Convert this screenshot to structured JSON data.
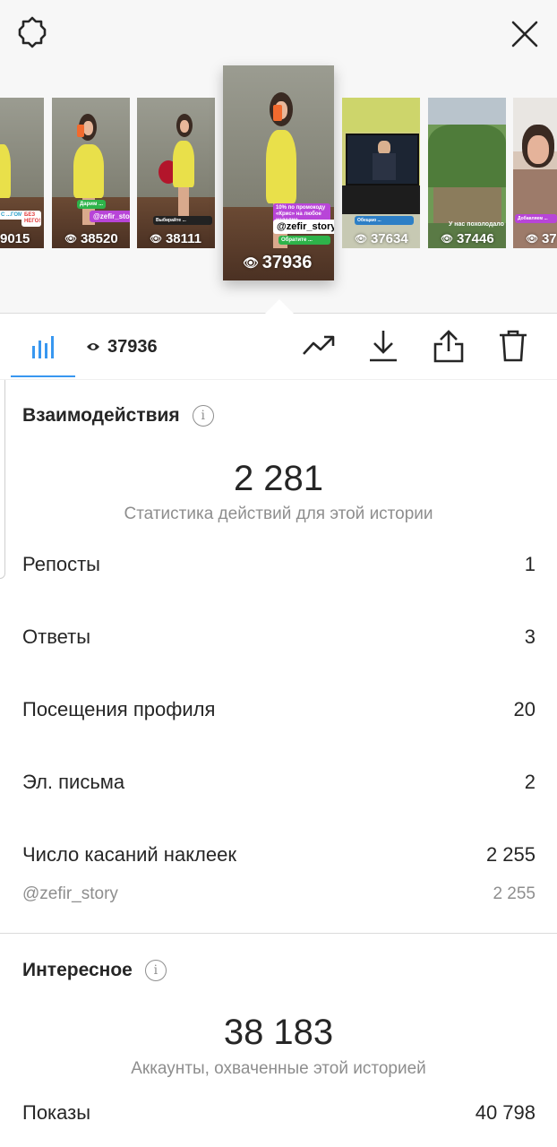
{
  "thumbnails": [
    {
      "views": "9015",
      "sticker_text": "С ...ГОМ",
      "sticker_text2": "БЕЗ НЕГО!"
    },
    {
      "views": "38520",
      "sticker_text": "@zefir_story"
    },
    {
      "views": "38111",
      "sticker_text": ""
    },
    {
      "views": "37936",
      "sticker_text": "@zefir_story",
      "promo_text": "10% по промокоду «Крис» на любое изделие"
    },
    {
      "views": "37634",
      "sticker_text": ""
    },
    {
      "views": "37446",
      "sticker_text": "У нас похолодало"
    },
    {
      "views": "37",
      "sticker_text": ""
    }
  ],
  "toolbar": {
    "views_count": "37936",
    "icons": [
      "bar-chart-icon",
      "eye-icon",
      "trend-icon",
      "download-icon",
      "share-icon",
      "trash-icon"
    ],
    "accent_color": "#3897f0"
  },
  "interactions": {
    "title": "Взаимодействия",
    "total": "2 281",
    "caption": "Статистика действий для этой истории",
    "rows": [
      {
        "label": "Репосты",
        "value": "1"
      },
      {
        "label": "Ответы",
        "value": "3"
      },
      {
        "label": "Посещения профиля",
        "value": "20"
      },
      {
        "label": "Эл. письма",
        "value": "2"
      },
      {
        "label": "Число касаний наклеек",
        "value": "2 255"
      }
    ],
    "sub_row": {
      "label": "@zefir_story",
      "value": "2 255"
    }
  },
  "discovery": {
    "title": "Интересное",
    "total": "38 183",
    "caption": "Аккаунты, охваченные этой историей",
    "rows": [
      {
        "label": "Показы",
        "value": "40 798"
      }
    ]
  }
}
